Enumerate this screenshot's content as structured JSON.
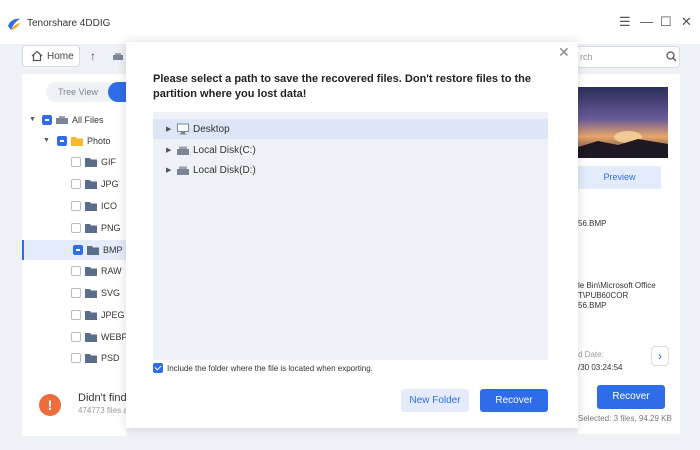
{
  "app": {
    "title": "Tenorshare 4DDIG"
  },
  "toolbar": {
    "home_label": "Home",
    "search_placeholder": "rch"
  },
  "sidebar": {
    "view_toggle_label": "Tree View",
    "tree": [
      {
        "label": "All Files",
        "checkbox": "partial",
        "expanded": true
      },
      {
        "label": "Photo",
        "checkbox": "partial",
        "expanded": true
      },
      {
        "label": "GIF",
        "checkbox": "unchecked"
      },
      {
        "label": "JPG",
        "checkbox": "unchecked"
      },
      {
        "label": "ICO",
        "checkbox": "unchecked"
      },
      {
        "label": "PNG",
        "checkbox": "unchecked"
      },
      {
        "label": "BMP",
        "checkbox": "partial",
        "selected": true
      },
      {
        "label": "RAW",
        "checkbox": "unchecked"
      },
      {
        "label": "SVG",
        "checkbox": "unchecked"
      },
      {
        "label": "JPEG",
        "checkbox": "unchecked"
      },
      {
        "label": "WEBP",
        "checkbox": "unchecked"
      },
      {
        "label": "PSD",
        "checkbox": "unchecked"
      }
    ]
  },
  "bottom": {
    "didnt_find": "Didn't find",
    "files_count": "474773 files a"
  },
  "right_panel": {
    "preview_label": "Preview",
    "filename": "56.BMP",
    "path_line1": "le Bin\\Microsoft Office",
    "path_line2": "T\\PUB60COR",
    "path_line3": "56.BMP",
    "date_label": "d Date:",
    "date_value": "/30 03:24:54",
    "recover_label": "Recover",
    "selected_info": "Selected: 3 files, 94.29 KB"
  },
  "dialog": {
    "title": "Please select a path to save the recovered files. Don't restore files to the partition where you lost data!",
    "paths": [
      {
        "label": "Desktop",
        "icon": "monitor-icon",
        "selected": true
      },
      {
        "label": "Local Disk(C:)",
        "icon": "drive-icon"
      },
      {
        "label": "Local Disk(D:)",
        "icon": "drive-icon"
      }
    ],
    "include_folder_label": "Include the folder where the file is located when exporting.",
    "new_folder_label": "New Folder",
    "recover_label": "Recover"
  },
  "colors": {
    "accent": "#2f6de8",
    "alert": "#ee6b3c",
    "panel_bg": "#eef1f6"
  }
}
